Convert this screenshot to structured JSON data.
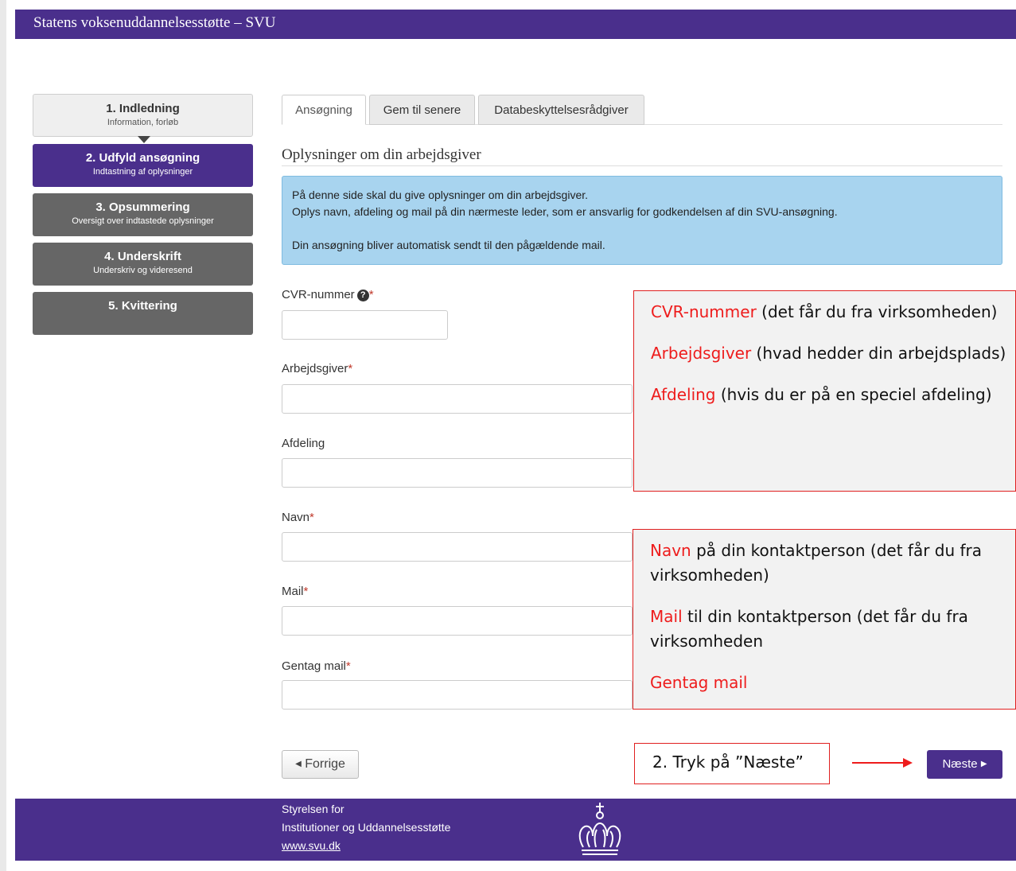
{
  "header": {
    "title": "Statens voksenuddannelsesstøtte – SVU"
  },
  "steps": [
    {
      "title": "1. Indledning",
      "subtitle": "Information, forløb"
    },
    {
      "title": "2. Udfyld ansøgning",
      "subtitle": "Indtastning af oplysninger"
    },
    {
      "title": "3. Opsummering",
      "subtitle": "Oversigt over indtastede oplysninger"
    },
    {
      "title": "4. Underskrift",
      "subtitle": "Underskriv og videresend"
    },
    {
      "title": "5. Kvittering",
      "subtitle": ""
    }
  ],
  "tabs": [
    {
      "label": "Ansøgning"
    },
    {
      "label": "Gem til senere"
    },
    {
      "label": "Databeskyttelsesrådgiver"
    }
  ],
  "section": {
    "heading": "Oplysninger om din arbejdsgiver"
  },
  "info": {
    "line1": "På denne side skal du give oplysninger om din arbejdsgiver.",
    "line2": "Oplys navn, afdeling og mail på din nærmeste leder, som er ansvarlig for godkendelsen af din SVU-ansøgning.",
    "line3": "Din ansøgning bliver automatisk sendt til den pågældende mail."
  },
  "fields": {
    "cvr": {
      "label": "CVR-nummer",
      "required": "*",
      "value": ""
    },
    "employer": {
      "label": "Arbejdsgiver",
      "required": "*",
      "value": ""
    },
    "department": {
      "label": "Afdeling",
      "value": ""
    },
    "name": {
      "label": "Navn",
      "required": "*",
      "value": ""
    },
    "mail": {
      "label": "Mail",
      "required": "*",
      "value": ""
    },
    "mail_repeat": {
      "label": "Gentag mail",
      "required": "*",
      "value": ""
    }
  },
  "help_icon": "question-circle-icon",
  "annotation1": {
    "p1_red": "CVR-nummer",
    "p1_rest": " (det får du fra virksomheden)",
    "p2_red": "Arbejdsgiver",
    "p2_rest": " (hvad hedder din arbejdsplads)",
    "p3_red": "Afdeling",
    "p3_rest": " (hvis du er på en speciel afdeling)"
  },
  "annotation2": {
    "p1_red": "Navn",
    "p1_rest": " på din kontaktperson (det får du fra virksomheden)",
    "p2_red": "Mail",
    "p2_rest": " til din kontaktperson (det får du fra virksomheden",
    "p3_red": "Gentag mail"
  },
  "annotation3": {
    "text": "2. Tryk på ”Næste”"
  },
  "buttons": {
    "prev": "Forrige",
    "next": "Næste"
  },
  "footer": {
    "line1": "Styrelsen for",
    "line2": "Institutioner og Uddannelsesstøtte",
    "link": "www.svu.dk",
    "logo": "crown-logo"
  },
  "colors": {
    "brand": "#4a2f8c",
    "info_bg": "#a8d4ef",
    "annotation_red": "#ee1c1c"
  }
}
